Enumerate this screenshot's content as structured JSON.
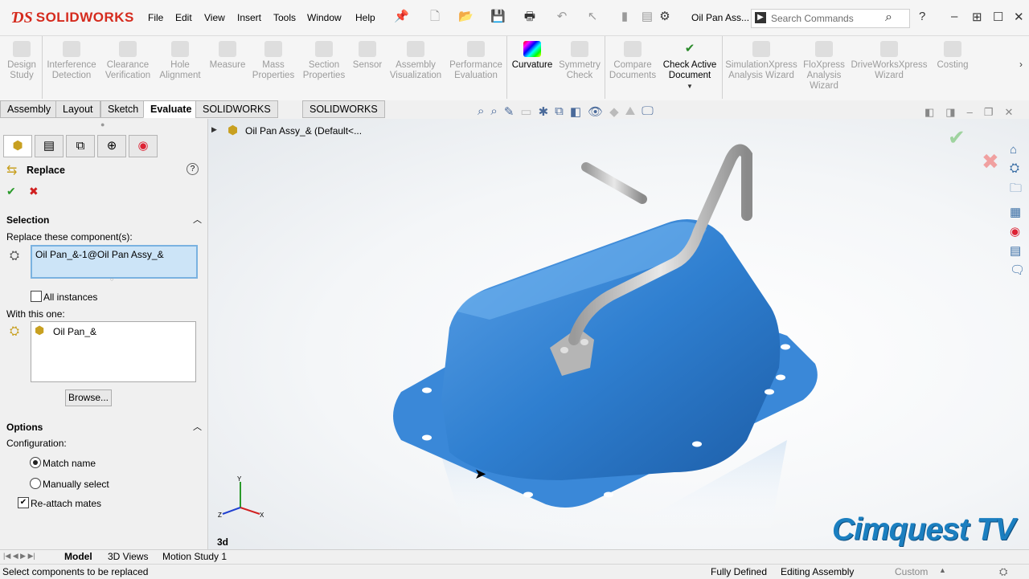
{
  "app": {
    "name": "SOLIDWORKS",
    "doc_title": "Oil Pan Ass..."
  },
  "menu": [
    "File",
    "Edit",
    "View",
    "Insert",
    "Tools",
    "Window",
    "Help"
  ],
  "search": {
    "placeholder": "Search Commands"
  },
  "commands": [
    {
      "label": "Design Study",
      "enabled": false
    },
    {
      "label": "Interference Detection",
      "enabled": false
    },
    {
      "label": "Clearance Verification",
      "enabled": false
    },
    {
      "label": "Hole Alignment",
      "enabled": false
    },
    {
      "label": "Measure",
      "enabled": false
    },
    {
      "label": "Mass Properties",
      "enabled": false
    },
    {
      "label": "Section Properties",
      "enabled": false
    },
    {
      "label": "Sensor",
      "enabled": false
    },
    {
      "label": "Assembly Visualization",
      "enabled": false
    },
    {
      "label": "Performance Evaluation",
      "enabled": false
    },
    {
      "label": "Curvature",
      "enabled": true
    },
    {
      "label": "Symmetry Check",
      "enabled": false
    },
    {
      "label": "Compare Documents",
      "enabled": false
    },
    {
      "label": "Check Active Document",
      "enabled": true
    },
    {
      "label": "SimulationXpress Analysis Wizard",
      "enabled": false
    },
    {
      "label": "FloXpress Analysis Wizard",
      "enabled": false
    },
    {
      "label": "DriveWorksXpress Wizard",
      "enabled": false
    },
    {
      "label": "Costing",
      "enabled": false
    }
  ],
  "tabs": [
    "Assembly",
    "Layout",
    "Sketch",
    "Evaluate",
    "SOLIDWORKS Add-Ins",
    "SOLIDWORKS MBD"
  ],
  "active_tab": "Evaluate",
  "property_manager": {
    "title": "Replace",
    "selection_header": "Selection",
    "replace_label": "Replace these component(s):",
    "replace_value": "Oil Pan_&-1@Oil Pan Assy_&",
    "all_instances": "All instances",
    "with_label": "With this one:",
    "with_value": "Oil Pan_&",
    "browse": "Browse...",
    "options_header": "Options",
    "configuration_label": "Configuration:",
    "match_name": "Match name",
    "manually_select": "Manually select",
    "reattach_mates": "Re-attach mates"
  },
  "tree": {
    "root": "Oil Pan Assy_&  (Default<..."
  },
  "viewport": {
    "view_label": "3d",
    "watermark": "Cimquest TV"
  },
  "bottom_tabs": [
    "Model",
    "3D Views",
    "Motion Study 1"
  ],
  "status": {
    "message": "Select components to be replaced",
    "state": "Fully Defined",
    "mode": "Editing Assembly",
    "units": "Custom"
  },
  "colors": {
    "brand": "#d52b1e",
    "pan_blue": "#2f7fd0",
    "selection": "#cce4f7",
    "watermark": "#1b7fc0"
  }
}
